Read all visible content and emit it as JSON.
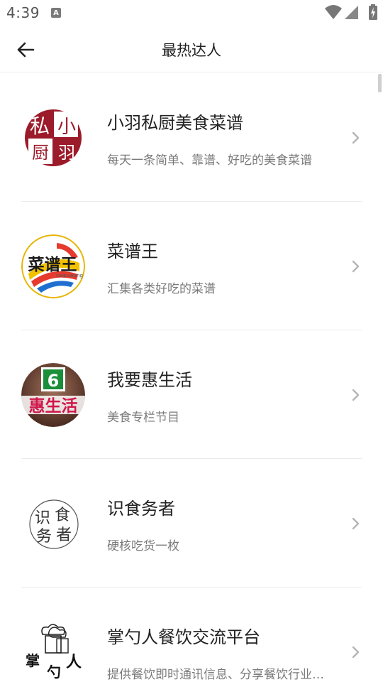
{
  "status_bar": {
    "time": "4:39",
    "notification_icon": "a-notification-icon",
    "wifi_icon": "wifi-icon",
    "signal_icon": "signal-icon",
    "battery_icon": "battery-charging-icon"
  },
  "app_bar": {
    "back_icon": "back-arrow-icon",
    "title": "最热达人"
  },
  "items": [
    {
      "name": "小羽私厨美食菜谱",
      "desc": "每天一条简单、靠谱、好吃的美食菜谱",
      "avatar": "xiaoyu-logo"
    },
    {
      "name": "菜谱王",
      "desc": "汇集各类好吃的菜谱",
      "avatar": "caipuwang-logo"
    },
    {
      "name": "我要惠生活",
      "desc": "美食专栏节目",
      "avatar": "huishenghuo-logo"
    },
    {
      "name": "识食务者",
      "desc": "硬核吃货一枚",
      "avatar": "shishiwuzhe-logo"
    },
    {
      "name": "掌勺人餐饮交流平台",
      "desc": "提供餐饮即时通讯信息、分享餐饮行业资讯",
      "avatar": "zhangshaoren-logo"
    }
  ],
  "logo_text": {
    "xiaoyu": [
      "私",
      "小",
      "厨",
      "羽"
    ],
    "caipuwang": "菜谱王",
    "caipuwang_sub": "caipuwang",
    "huishenghuo_num": "6",
    "huishenghuo": "惠生活",
    "shishiwuzhe": [
      "识",
      "食",
      "务",
      "者"
    ],
    "zhangshaoren": [
      "掌",
      "勺",
      "人"
    ]
  }
}
